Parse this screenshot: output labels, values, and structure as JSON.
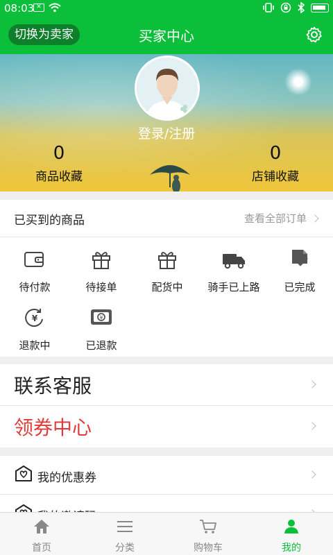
{
  "status_bar": {
    "time": "08:03"
  },
  "header": {
    "switch_label": "切换为卖家",
    "title": "买家中心"
  },
  "profile": {
    "login_label": "登录/注册",
    "stats": [
      {
        "value": "0",
        "label": "商品收藏"
      },
      {
        "value": "0",
        "label": "店铺收藏"
      }
    ]
  },
  "orders": {
    "title": "已买到的商品",
    "view_all": "查看全部订单",
    "items": [
      {
        "label": "待付款",
        "icon": "wallet-icon"
      },
      {
        "label": "待接单",
        "icon": "gift-icon"
      },
      {
        "label": "配货中",
        "icon": "gift-icon"
      },
      {
        "label": "骑手已上路",
        "icon": "truck-icon"
      },
      {
        "label": "已完成",
        "icon": "document-check-icon"
      },
      {
        "label": "退款中",
        "icon": "yuan-refund-icon"
      },
      {
        "label": "已退款",
        "icon": "wallet-refund-icon"
      }
    ]
  },
  "menu": {
    "contact": "联系客服",
    "coupon_center": "领券中心",
    "my_coupons": "我的优惠券",
    "invite_code": "我的邀请码"
  },
  "colors": {
    "primary": "#0bbf3a",
    "coupon_red": "#e03a3a"
  },
  "tabs": [
    {
      "label": "首页",
      "icon": "home-icon"
    },
    {
      "label": "分类",
      "icon": "menu-lines-icon"
    },
    {
      "label": "购物车",
      "icon": "cart-icon"
    },
    {
      "label": "我的",
      "icon": "person-icon",
      "active": true
    }
  ]
}
